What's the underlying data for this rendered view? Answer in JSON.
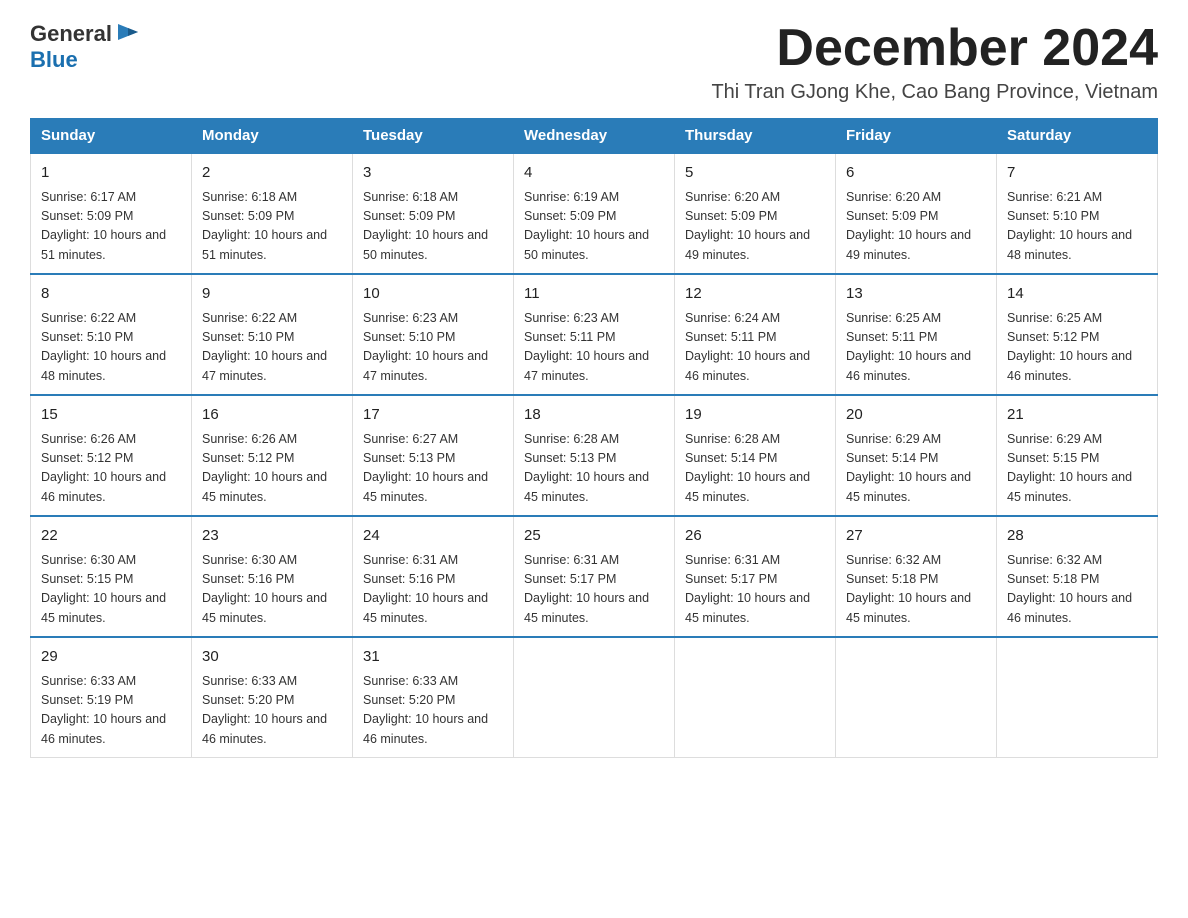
{
  "header": {
    "logo_general": "General",
    "logo_blue": "Blue",
    "month_title": "December 2024",
    "location": "Thi Tran GJong Khe, Cao Bang Province, Vietnam"
  },
  "days_of_week": [
    "Sunday",
    "Monday",
    "Tuesday",
    "Wednesday",
    "Thursday",
    "Friday",
    "Saturday"
  ],
  "weeks": [
    [
      {
        "day": "1",
        "sunrise": "6:17 AM",
        "sunset": "5:09 PM",
        "daylight": "10 hours and 51 minutes."
      },
      {
        "day": "2",
        "sunrise": "6:18 AM",
        "sunset": "5:09 PM",
        "daylight": "10 hours and 51 minutes."
      },
      {
        "day": "3",
        "sunrise": "6:18 AM",
        "sunset": "5:09 PM",
        "daylight": "10 hours and 50 minutes."
      },
      {
        "day": "4",
        "sunrise": "6:19 AM",
        "sunset": "5:09 PM",
        "daylight": "10 hours and 50 minutes."
      },
      {
        "day": "5",
        "sunrise": "6:20 AM",
        "sunset": "5:09 PM",
        "daylight": "10 hours and 49 minutes."
      },
      {
        "day": "6",
        "sunrise": "6:20 AM",
        "sunset": "5:09 PM",
        "daylight": "10 hours and 49 minutes."
      },
      {
        "day": "7",
        "sunrise": "6:21 AM",
        "sunset": "5:10 PM",
        "daylight": "10 hours and 48 minutes."
      }
    ],
    [
      {
        "day": "8",
        "sunrise": "6:22 AM",
        "sunset": "5:10 PM",
        "daylight": "10 hours and 48 minutes."
      },
      {
        "day": "9",
        "sunrise": "6:22 AM",
        "sunset": "5:10 PM",
        "daylight": "10 hours and 47 minutes."
      },
      {
        "day": "10",
        "sunrise": "6:23 AM",
        "sunset": "5:10 PM",
        "daylight": "10 hours and 47 minutes."
      },
      {
        "day": "11",
        "sunrise": "6:23 AM",
        "sunset": "5:11 PM",
        "daylight": "10 hours and 47 minutes."
      },
      {
        "day": "12",
        "sunrise": "6:24 AM",
        "sunset": "5:11 PM",
        "daylight": "10 hours and 46 minutes."
      },
      {
        "day": "13",
        "sunrise": "6:25 AM",
        "sunset": "5:11 PM",
        "daylight": "10 hours and 46 minutes."
      },
      {
        "day": "14",
        "sunrise": "6:25 AM",
        "sunset": "5:12 PM",
        "daylight": "10 hours and 46 minutes."
      }
    ],
    [
      {
        "day": "15",
        "sunrise": "6:26 AM",
        "sunset": "5:12 PM",
        "daylight": "10 hours and 46 minutes."
      },
      {
        "day": "16",
        "sunrise": "6:26 AM",
        "sunset": "5:12 PM",
        "daylight": "10 hours and 45 minutes."
      },
      {
        "day": "17",
        "sunrise": "6:27 AM",
        "sunset": "5:13 PM",
        "daylight": "10 hours and 45 minutes."
      },
      {
        "day": "18",
        "sunrise": "6:28 AM",
        "sunset": "5:13 PM",
        "daylight": "10 hours and 45 minutes."
      },
      {
        "day": "19",
        "sunrise": "6:28 AM",
        "sunset": "5:14 PM",
        "daylight": "10 hours and 45 minutes."
      },
      {
        "day": "20",
        "sunrise": "6:29 AM",
        "sunset": "5:14 PM",
        "daylight": "10 hours and 45 minutes."
      },
      {
        "day": "21",
        "sunrise": "6:29 AM",
        "sunset": "5:15 PM",
        "daylight": "10 hours and 45 minutes."
      }
    ],
    [
      {
        "day": "22",
        "sunrise": "6:30 AM",
        "sunset": "5:15 PM",
        "daylight": "10 hours and 45 minutes."
      },
      {
        "day": "23",
        "sunrise": "6:30 AM",
        "sunset": "5:16 PM",
        "daylight": "10 hours and 45 minutes."
      },
      {
        "day": "24",
        "sunrise": "6:31 AM",
        "sunset": "5:16 PM",
        "daylight": "10 hours and 45 minutes."
      },
      {
        "day": "25",
        "sunrise": "6:31 AM",
        "sunset": "5:17 PM",
        "daylight": "10 hours and 45 minutes."
      },
      {
        "day": "26",
        "sunrise": "6:31 AM",
        "sunset": "5:17 PM",
        "daylight": "10 hours and 45 minutes."
      },
      {
        "day": "27",
        "sunrise": "6:32 AM",
        "sunset": "5:18 PM",
        "daylight": "10 hours and 45 minutes."
      },
      {
        "day": "28",
        "sunrise": "6:32 AM",
        "sunset": "5:18 PM",
        "daylight": "10 hours and 46 minutes."
      }
    ],
    [
      {
        "day": "29",
        "sunrise": "6:33 AM",
        "sunset": "5:19 PM",
        "daylight": "10 hours and 46 minutes."
      },
      {
        "day": "30",
        "sunrise": "6:33 AM",
        "sunset": "5:20 PM",
        "daylight": "10 hours and 46 minutes."
      },
      {
        "day": "31",
        "sunrise": "6:33 AM",
        "sunset": "5:20 PM",
        "daylight": "10 hours and 46 minutes."
      },
      null,
      null,
      null,
      null
    ]
  ]
}
